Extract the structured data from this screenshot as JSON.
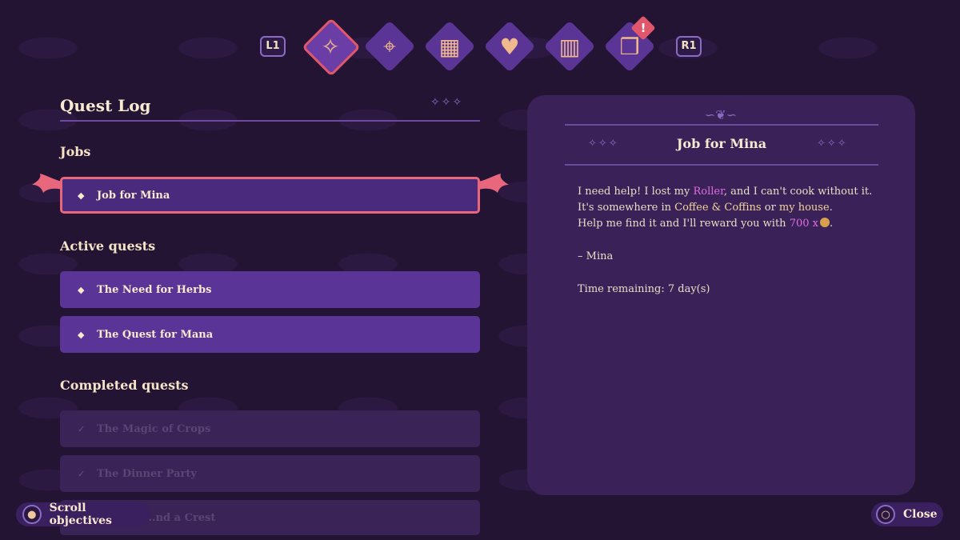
{
  "nav": {
    "left_shoulder": "L1",
    "right_shoulder": "R1",
    "tabs": [
      {
        "icon": "quest-scroll-icon",
        "glyph": "✧",
        "active": true
      },
      {
        "icon": "map-icon",
        "glyph": "⌖",
        "active": false
      },
      {
        "icon": "calendar-icon",
        "glyph": "▦",
        "active": false
      },
      {
        "icon": "heart-icon",
        "glyph": "♥",
        "active": false
      },
      {
        "icon": "wardrobe-icon",
        "glyph": "▥",
        "active": false
      },
      {
        "icon": "recipe-book-icon",
        "glyph": "❒",
        "active": false
      }
    ],
    "alert_badge": "!"
  },
  "quest_log": {
    "title": "Quest Log",
    "title_deco": "✧✧✧",
    "jobs_label": "Jobs",
    "jobs": [
      {
        "name": "Job for Mina",
        "bullet": "◆"
      }
    ],
    "active_label": "Active quests",
    "active": [
      {
        "name": "The Need for Herbs",
        "bullet": "◆"
      },
      {
        "name": "The Quest for Mana",
        "bullet": "◆"
      }
    ],
    "completed_label": "Completed quests",
    "completed": [
      {
        "name": "The Magic of Crops",
        "bullet": "✓"
      },
      {
        "name": "The Dinner Party",
        "bullet": "✓"
      },
      {
        "name": "...nd a Crest",
        "bullet": "✓"
      }
    ]
  },
  "detail": {
    "title": "Job for Mina",
    "deco_left": "✧✧✧",
    "deco_right": "✧✧✧",
    "curl": "∽❦∽",
    "line1_a": "I need help! I lost my ",
    "line1_item": "Roller",
    "line1_b": ", and I can't cook without it.",
    "line2_a": "It's somewhere in ",
    "line2_place1": "Coffee & Coffins",
    "line2_b": " or ",
    "line2_place2": "my house",
    "line2_c": ".",
    "line3_a": "Help me find it and I'll reward you with ",
    "line3_reward": "700 x",
    "line3_b": ".",
    "signature": "– Mina",
    "time_remaining": "Time remaining: 7 day(s)"
  },
  "prompts": {
    "scroll_label": "Scroll objectives",
    "scroll_icon": "right-stick-icon",
    "close_label": "Close",
    "close_icon": "circle-button-icon",
    "close_glyph": "○"
  },
  "colors": {
    "background": "#231433",
    "accent_selected": "#e9677c",
    "quest_active": "#5a3597",
    "panel": "#3a2258",
    "highlight_item": "#e06ee0",
    "highlight_place": "#f2d49a"
  }
}
